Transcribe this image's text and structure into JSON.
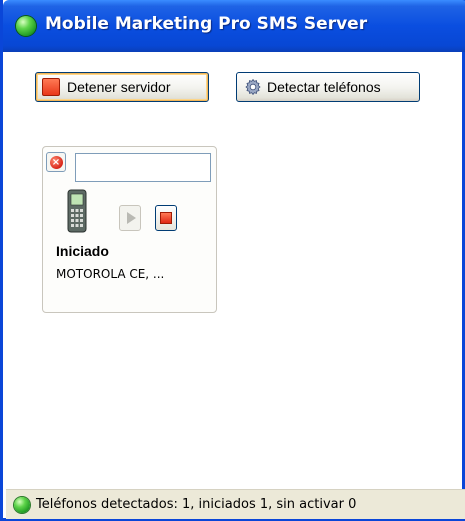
{
  "window": {
    "title": "Mobile Marketing Pro SMS Server",
    "title_bar_color": "#0a4ee0"
  },
  "toolbar": {
    "stop_server_label": "Detener servidor",
    "detect_phones_label": "Detectar teléfonos"
  },
  "device_card": {
    "name_value": "",
    "status": "Iniciado",
    "device_name": "MOTOROLA CE, ..."
  },
  "statusbar": {
    "text": "Teléfonos detectados: 1,  iniciados 1, sin activar 0",
    "indicator_color": "#2ea52e"
  }
}
